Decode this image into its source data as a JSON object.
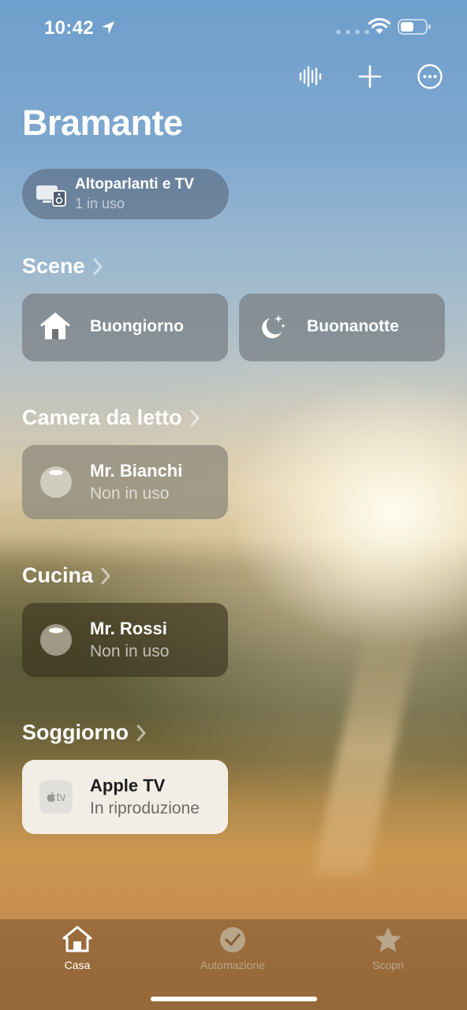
{
  "status_bar": {
    "time": "10:42"
  },
  "home": {
    "title": "Bramante",
    "speakers_pill": {
      "title": "Altoparlanti e TV",
      "subtitle": "1 in uso"
    }
  },
  "sections": {
    "scene": {
      "title": "Scene"
    },
    "camera": {
      "title": "Camera da letto"
    },
    "cucina": {
      "title": "Cucina"
    },
    "soggiorno": {
      "title": "Soggiorno"
    }
  },
  "scenes": [
    {
      "label": "Buongiorno",
      "icon": "house-icon"
    },
    {
      "label": "Buonanotte",
      "icon": "moon-icon"
    }
  ],
  "accessories": {
    "bedroom": {
      "name": "Mr. Bianchi",
      "state": "Non in uso",
      "icon": "homepod-mini-icon"
    },
    "kitchen": {
      "name": "Mr. Rossi",
      "state": "Non in uso",
      "icon": "homepod-mini-icon"
    },
    "living": {
      "name": "Apple TV",
      "state": "In riproduzione",
      "icon": "apple-tv-icon",
      "icon_text": "tv"
    }
  },
  "tab_bar": {
    "tabs": [
      {
        "label": "Casa",
        "icon": "house-icon",
        "active": true
      },
      {
        "label": "Automazione",
        "icon": "clock-check-icon",
        "active": false
      },
      {
        "label": "Scopri",
        "icon": "star-icon",
        "active": false
      }
    ]
  },
  "colors": {
    "active_tab": "#ffffff",
    "inactive_tab": "#b9a58a",
    "playing_tile": "#f2eee6"
  }
}
